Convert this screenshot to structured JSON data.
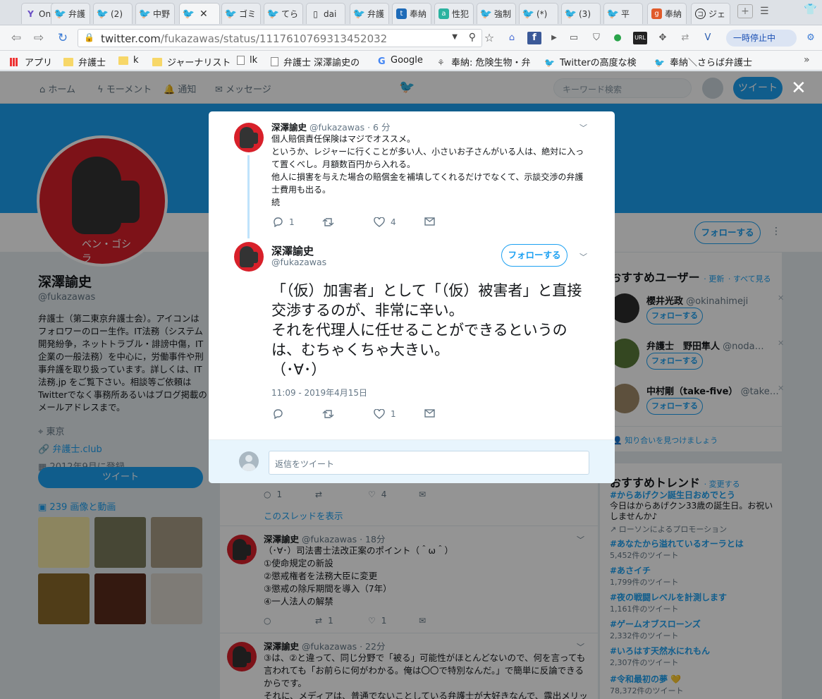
{
  "browser": {
    "tabs": [
      {
        "label": "One",
        "icon": "y"
      },
      {
        "label": "弁護",
        "icon": "twitter"
      },
      {
        "label": "(2)",
        "icon": "twitter"
      },
      {
        "label": "中野",
        "icon": "twitter"
      },
      {
        "label": "",
        "icon": "twitter",
        "active": true
      },
      {
        "label": "ゴミ",
        "icon": "twitter"
      },
      {
        "label": "てら",
        "icon": "twitter"
      },
      {
        "label": "dai",
        "icon": "doc"
      },
      {
        "label": "弁護",
        "icon": "twitter"
      },
      {
        "label": "奉納",
        "icon": "t"
      },
      {
        "label": "性犯",
        "icon": "a"
      },
      {
        "label": "強制",
        "icon": "twitter"
      },
      {
        "label": "(*)",
        "icon": "twitter"
      },
      {
        "label": "(3)",
        "icon": "twitter"
      },
      {
        "label": "平",
        "icon": "twitter"
      },
      {
        "label": "奉納",
        "icon": "g"
      },
      {
        "label": "ジェ",
        "icon": "o"
      }
    ],
    "active_tab_close": "✕",
    "url_host": "twitter.com",
    "url_path": "/fukazawas/status/1117610769313452032",
    "pause_label": "一時停止中",
    "bookmarks": [
      {
        "label": "アプリ",
        "icon": "grid"
      },
      {
        "label": "弁護士",
        "icon": "folder"
      },
      {
        "label": "k",
        "icon": "folder"
      },
      {
        "label": "ジャーナリスト",
        "icon": "folder"
      },
      {
        "label": "lk",
        "icon": "doc"
      },
      {
        "label": "弁護士 深澤諭史の",
        "icon": "doc"
      },
      {
        "label": "Google",
        "icon": "google"
      },
      {
        "label": "奉納: 危険生物・弁",
        "icon": "other"
      },
      {
        "label": "Twitterの高度な検",
        "icon": "twitter"
      },
      {
        "label": "奉納＼さらば弁護士",
        "icon": "twitter"
      }
    ]
  },
  "twitter_nav": {
    "home": "ホーム",
    "moments": "モーメント",
    "notifications": "通知",
    "messages": "メッセージ",
    "search_placeholder": "キーワード検索",
    "tweet_button": "ツイート",
    "follow_button": "フォローする"
  },
  "profile": {
    "name": "深澤諭史",
    "handle": "@fukazawas",
    "bio": "弁護士（第二東京弁護士会）。アイコンはフォロワーのロー生作。IT法務（システム開発紛争，ネットトラブル・誹謗中傷，IT企業の一般法務）を中心に，労働事件や刑事弁護を取り扱っています。詳しくは、IT法務.jp をご覧下さい。相談等ご依頼はTwitterでなく事務所あるいはブログ掲載のメールアドレスまで。",
    "location": "東京",
    "website": "弁護士.club",
    "joined": "2012年9月に登録",
    "tweet_button": "ツイート",
    "media_link": "239 画像と動画"
  },
  "modal": {
    "parent_tweet": {
      "name": "深澤諭史",
      "handle": "@fukazawas",
      "time": "· 6 分",
      "lines": [
        "個人賠償責任保険はマジでオススメ。",
        "というか、レジャーに行くことが多い人、小さいお子さんがいる人は、絶対に入って置くべし。月額数百円から入れる。",
        "他人に損害を与えた場合の賠償金を補填してくれるだけでなくて、示談交渉の弁護士費用も出る。",
        "続"
      ],
      "replies": "1",
      "retweets": "",
      "likes": "4"
    },
    "main_tweet": {
      "name": "深澤諭史",
      "handle": "@fukazawas",
      "follow_button": "フォローする",
      "text": "「（仮）加害者」として「（仮）被害者」と直接交渉するのが、非常に辛い。\nそれを代理人に任せることができるというのは、むちゃくちゃ大きい。\n（･∀･）",
      "timestamp": "11:09 - 2019年4月15日",
      "replies": "",
      "retweets": "",
      "likes": "1"
    },
    "reply_placeholder": "返信をツイート"
  },
  "stream": {
    "first_counts": {
      "replies": "1",
      "retweets": "",
      "likes": "4"
    },
    "show_thread": "このスレッドを表示",
    "tweets": [
      {
        "name": "深澤諭史",
        "handle": "@fukazawas",
        "time": "· 18分",
        "lines": [
          "（･∀･）司法書士法改正案のポイント（＾ω＾）",
          "①使命規定の新設",
          "②懲戒権者を法務大臣に変更",
          "③懲戒の除斥期間を導入（7年）",
          "④一人法人の解禁"
        ],
        "replies": "",
        "retweets": "1",
        "likes": "1"
      },
      {
        "name": "深澤諭史",
        "handle": "@fukazawas",
        "time": "· 22分",
        "lines": [
          "③は、②と違って、同じ分野で「被る」可能性がほとんどないので、何を言っても言われても「お前らに何がわかる。俺は〇〇で特別なんだ。」で簡単に反論できるからです。",
          "それに、メディアは、普通でないことしている弁護士が大好きなんで、露出メリットも高いです。"
        ]
      }
    ]
  },
  "who_to_follow": {
    "title": "おすすめユーザー",
    "refresh": "· 更新",
    "view_all": "· すべて見る",
    "users": [
      {
        "name": "櫻井光政",
        "handle": "@okinahimeji"
      },
      {
        "name": "弁護士　野田隼人",
        "handle": "@noda…"
      },
      {
        "name": "中村剛（take-five）",
        "handle": "@take…"
      }
    ],
    "find_friends": "知り合いを見つけましょう"
  },
  "trends": {
    "title": "おすすめトレンド",
    "change": "· 変更する",
    "items": [
      {
        "name": "#からあげクン誕生日おめでとう",
        "desc": "今日はからあげクン33歳の誕生日。お祝いしませんか♪",
        "promo": "ローソンによるプロモーション"
      },
      {
        "name": "#あなたから溢れているオーラとは",
        "count": "5,452件のツイート"
      },
      {
        "name": "#あさイチ",
        "count": "1,799件のツイート"
      },
      {
        "name": "#夜の戦闘レベルを計測します",
        "count": "1,161件のツイート"
      },
      {
        "name": "#ゲームオブスローンズ",
        "count": "2,332件のツイート"
      },
      {
        "name": "#いろはす天然水にれもん",
        "count": "2,307件のツイート"
      },
      {
        "name": "#令和最初の夢 💛",
        "count": "78,372件のツイート"
      }
    ]
  },
  "colors": {
    "twitter_blue": "#1da1f2",
    "text": "#14171a",
    "muted": "#657786",
    "avatar_red": "#d8202a"
  }
}
